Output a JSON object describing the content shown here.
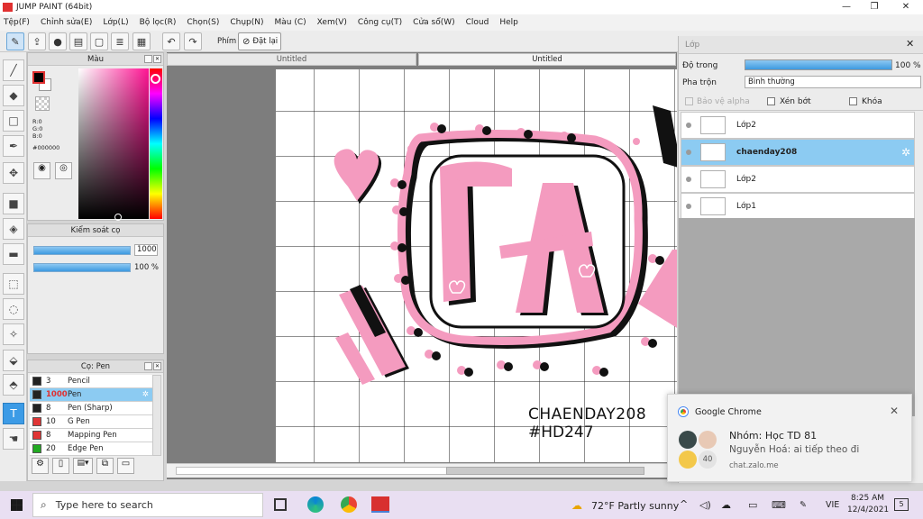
{
  "window": {
    "title": "JUMP PAINT (64bit)",
    "minimize": "—",
    "maximize": "❐",
    "close": "✕"
  },
  "menu": [
    "Tệp(F)",
    "Chỉnh sửa(E)",
    "Lớp(L)",
    "Bộ lọc(R)",
    "Chọn(S)",
    "Chụp(N)",
    "Màu (C)",
    "Xem(V)",
    "Công cụ(T)",
    "Cửa sổ(W)",
    "Cloud",
    "Help"
  ],
  "toolbar": {
    "key_label": "Phím",
    "reset_label": "Đặt lại"
  },
  "color_panel": {
    "title": "Màu",
    "r": "R:0",
    "g": "G:0",
    "b": "B:0",
    "hex": "#000000"
  },
  "brush_control": {
    "title": "Kiểm soát cọ",
    "size_value": "1000",
    "opacity_value": "100 %"
  },
  "brush_panel": {
    "title": "Cọ: Pen",
    "items": [
      {
        "num": "3",
        "name": "Pencil",
        "color": "#222222",
        "selected": false
      },
      {
        "num": "1000",
        "name": "Pen",
        "color": "#222222",
        "selected": true
      },
      {
        "num": "8",
        "name": "Pen (Sharp)",
        "color": "#222222",
        "selected": false
      },
      {
        "num": "10",
        "name": "G Pen",
        "color": "#e03535",
        "selected": false
      },
      {
        "num": "8",
        "name": "Mapping Pen",
        "color": "#e03535",
        "selected": false
      },
      {
        "num": "20",
        "name": "Edge Pen",
        "color": "#22aa22",
        "selected": false
      }
    ]
  },
  "tabs": [
    "Untitled",
    "Untitled"
  ],
  "artwork": {
    "line1": "CHAENDAY208",
    "line2": "#HD247"
  },
  "layer_panel": {
    "title": "Lớp",
    "opacity_label": "Độ trong",
    "opacity_value": "100 %",
    "opacity_fraction": 1.0,
    "blend_label": "Pha trộn",
    "blend_value": "Bình thường",
    "protect_alpha": "Bảo vệ alpha",
    "clipping": "Xén bớt",
    "lock": "Khóa",
    "layers": [
      {
        "name": "Lớp2",
        "selected": false
      },
      {
        "name": "chaenday208",
        "selected": true
      },
      {
        "name": "Lớp2",
        "selected": false
      },
      {
        "name": "Lớp1",
        "selected": false
      }
    ]
  },
  "notification": {
    "app": "Google Chrome",
    "title": "Nhóm: Học TD 81",
    "message": "Nguyễn Hoá: ai tiếp theo đi",
    "source": "chat.zalo.me",
    "avatar_count": "40"
  },
  "taskbar": {
    "search_placeholder": "Type here to search",
    "weather": "72°F  Partly sunny",
    "lang": "VIE",
    "time": "8:25 AM",
    "date": "12/4/2021",
    "notif_count": "5"
  },
  "colors": {
    "accent": "#3c9be6",
    "art_pink": "#f49bbf",
    "selection": "#8ccbf2"
  }
}
